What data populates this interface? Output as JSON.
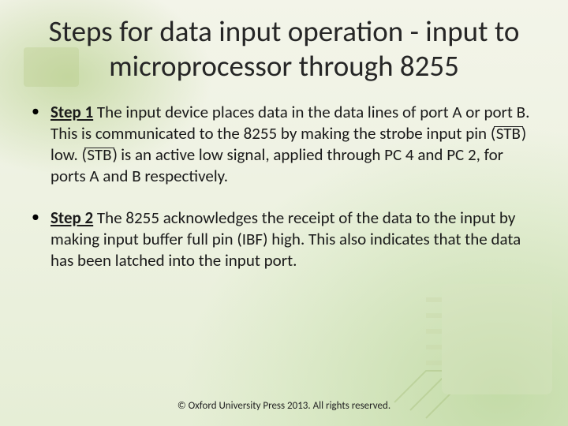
{
  "title": "Steps for data input operation - input to microprocessor through 8255",
  "steps": [
    {
      "label": "Step 1",
      "text_1": " The input device places data in the data lines of port A or port B. This is communicated to the 8255 by making the strobe input pin ",
      "sig_1": "STB",
      "text_2": " low. ",
      "sig_2": "STB",
      "text_3": " is an active low signal, applied through PC 4 and PC 2, for ports A and B respectively."
    },
    {
      "label": "Step 2",
      "text_1": " The 8255 acknowledges the receipt of the data to the input by making input buffer full pin (IBF) high. This also indicates that the data has been latched into the input port."
    }
  ],
  "footer": "© Oxford University Press 2013. All rights reserved."
}
